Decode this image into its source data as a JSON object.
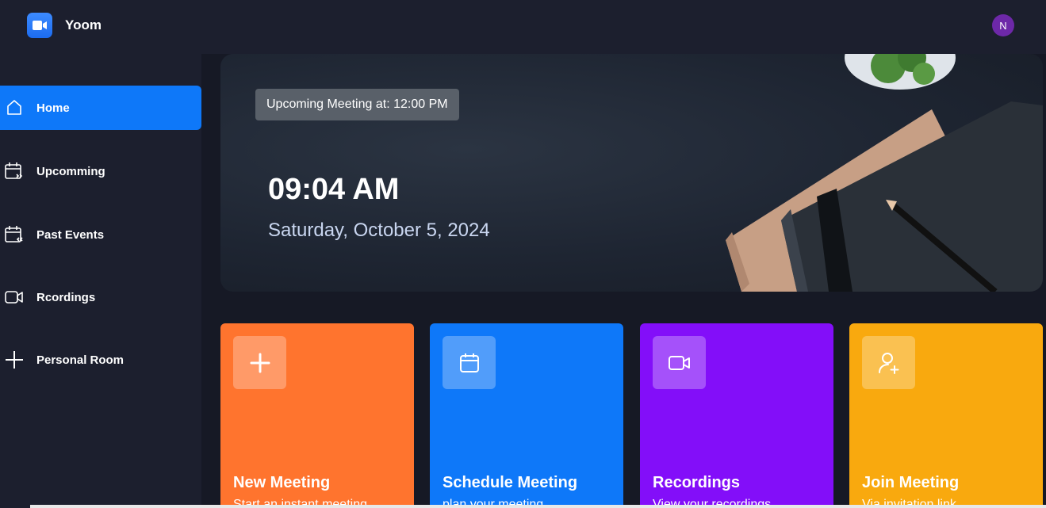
{
  "app": {
    "name": "Yoom",
    "user_initial": "N"
  },
  "sidebar": {
    "items": [
      {
        "label": "Home",
        "icon": "home-icon",
        "active": true
      },
      {
        "label": "Upcomming",
        "icon": "calendar-forward-icon",
        "active": false
      },
      {
        "label": "Past Events",
        "icon": "calendar-back-icon",
        "active": false
      },
      {
        "label": "Rcordings",
        "icon": "video-icon",
        "active": false
      },
      {
        "label": "Personal Room",
        "icon": "plus-icon",
        "active": false
      }
    ]
  },
  "hero": {
    "badge": "Upcoming Meeting at: 12:00 PM",
    "time": "09:04 AM",
    "date": "Saturday, October 5, 2024"
  },
  "cards": [
    {
      "title": "New Meeting",
      "subtitle": "Start an instant meeting",
      "icon": "plus-icon",
      "color": "#ff742e"
    },
    {
      "title": "Schedule Meeting",
      "subtitle": "plan your meeting",
      "icon": "calendar-icon",
      "color": "#0e78f9"
    },
    {
      "title": "Recordings",
      "subtitle": "View your recordings",
      "icon": "video-icon",
      "color": "#830ef9"
    },
    {
      "title": "Join Meeting",
      "subtitle": "Via invitation link",
      "icon": "add-user-icon",
      "color": "#f9a90e"
    }
  ],
  "colors": {
    "accent": "#0e78f9",
    "background": "#161925",
    "panel": "#1c1f2e"
  }
}
